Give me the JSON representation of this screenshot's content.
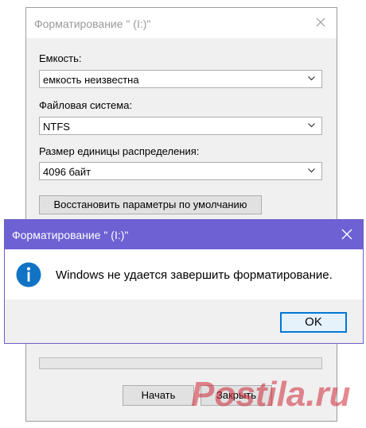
{
  "format_dialog": {
    "title": "Форматирование \" (I:)\"",
    "capacity": {
      "label": "Емкость:",
      "value": "емкость неизвестна"
    },
    "filesystem": {
      "label": "Файловая система:",
      "value": "NTFS"
    },
    "allocation": {
      "label": "Размер единицы распределения:",
      "value": "4096 байт"
    },
    "restore_defaults_label": "Восстановить параметры по умолчанию",
    "start_label": "Начать",
    "close_label": "Закрыть"
  },
  "message_box": {
    "title": "Форматирование \" (I:)\"",
    "text": "Windows не удается завершить форматирование.",
    "ok_label": "OK"
  },
  "watermark": {
    "text": "Postila.ru"
  },
  "colors": {
    "title_bar_accent": "#6e61d3",
    "info_icon": "#1173c4",
    "ok_border": "#0078d7"
  },
  "icons": {
    "info": "info-icon",
    "close": "close-icon",
    "dropdown": "chevron-down-icon"
  }
}
